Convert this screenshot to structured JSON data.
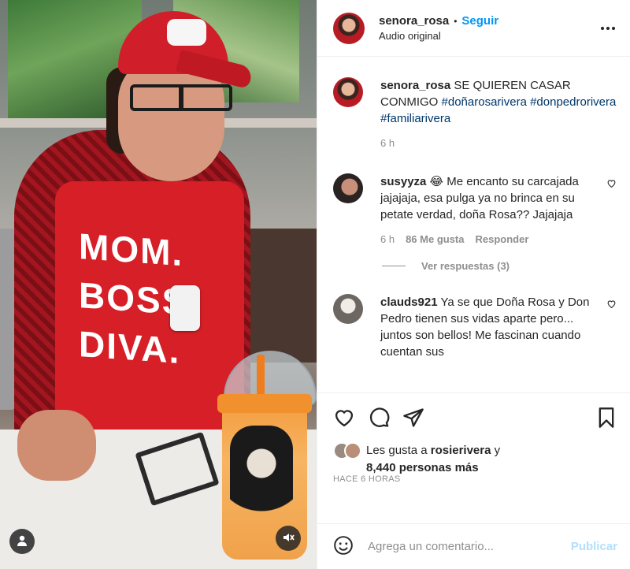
{
  "post": {
    "username": "senora_rosa",
    "follow_label": "Seguir",
    "separator": "•",
    "audio": "Audio original",
    "apron_text": "MOM. BOSS, DIVA."
  },
  "caption": {
    "username": "senora_rosa",
    "text": "SE QUIEREN CASAR CONMIGO",
    "hashtags": [
      "#doñarosarivera",
      "#donpedrorivera",
      "#familiarivera"
    ],
    "time": "6 h"
  },
  "comments": [
    {
      "username": "susyyza",
      "text": "😂 Me encanto su carcajada jajajaja, esa pulga ya no brinca en su petate verdad, doña Rosa?? Jajajaja",
      "time": "6 h",
      "likes": "86 Me gusta",
      "reply_label": "Responder",
      "view_replies": "Ver respuestas (3)"
    },
    {
      "username": "clauds921",
      "text": "Ya se que Doña Rosa y Don Pedro tienen sus vidas aparte pero... juntos son bellos! Me fascinan cuando cuentan sus"
    }
  ],
  "likes": {
    "prefix": "Les gusta a",
    "user": "rosierivera",
    "conj": "y",
    "others": "8,440 personas más"
  },
  "time_ago": "HACE 6 HORAS",
  "composer": {
    "placeholder": "Agrega un comentario...",
    "publish_label": "Publicar"
  },
  "icons": {
    "like": "heart-icon",
    "comment": "comment-icon",
    "share": "paper-plane-icon",
    "save": "bookmark-icon",
    "emoji": "smiley-icon",
    "mute": "speaker-muted-icon",
    "tags": "user-tag-icon"
  },
  "colors": {
    "accent": "#0095f6",
    "publish_disabled": "#b2dffc",
    "text": "#262626",
    "secondary": "#8e8e8e",
    "hashtag": "#00376b"
  }
}
